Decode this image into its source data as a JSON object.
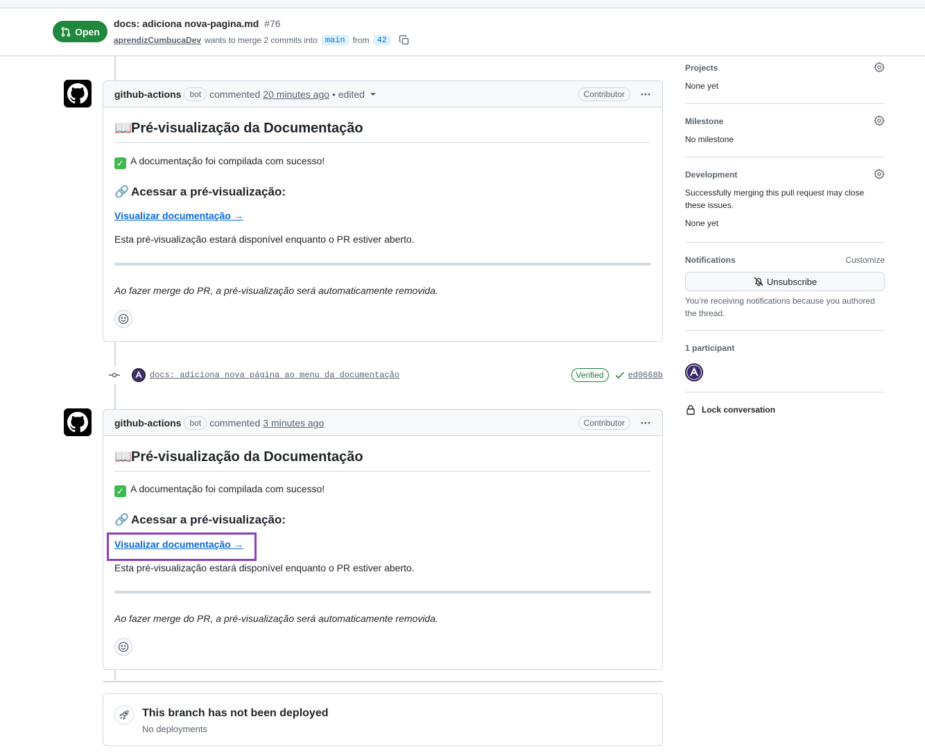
{
  "header": {
    "state": "Open",
    "title": "docs: adiciona nova-pagina.md",
    "number": "#76",
    "author": "aprendizCumbucaDev",
    "merge_text": "wants to merge 2 commits into",
    "base_branch": "main",
    "from_text": "from",
    "head_branch": "42"
  },
  "comments": [
    {
      "author": "github-actions",
      "bot_label": "bot",
      "action": "commented",
      "time": "20 minutes ago",
      "edited": "• edited",
      "role": "Contributor",
      "heading": "Pré-visualização da Documentação",
      "heading_emoji": "📖",
      "success": "A documentação foi compilada com sucesso!",
      "success_emoji": "✓",
      "access_heading": "Acessar a pré-visualização:",
      "access_emoji": "🔗",
      "link": "Visualizar documentação →",
      "availability": "Esta pré-visualização estará disponível enquanto o PR estiver aberto.",
      "footer_note": "Ao fazer merge do PR, a pré-visualização será automaticamente removida."
    },
    {
      "author": "github-actions",
      "bot_label": "bot",
      "action": "commented",
      "time": "3 minutes ago",
      "role": "Contributor",
      "heading": "Pré-visualização da Documentação",
      "heading_emoji": "📖",
      "success": "A documentação foi compilada com sucesso!",
      "success_emoji": "✓",
      "access_heading": "Acessar a pré-visualização:",
      "access_emoji": "🔗",
      "link": "Visualizar documentação →",
      "availability": "Esta pré-visualização estará disponível enquanto o PR estiver aberto.",
      "footer_note": "Ao fazer merge do PR, a pré-visualização será automaticamente removida."
    }
  ],
  "commit": {
    "message": "docs: adiciona nova página ao menu da documentação",
    "verified": "Verified",
    "sha": "ed0668b"
  },
  "deploy": {
    "title": "This branch has not been deployed",
    "subtitle": "No deployments"
  },
  "sidebar": {
    "projects": {
      "heading": "Projects",
      "value": "None yet"
    },
    "milestone": {
      "heading": "Milestone",
      "value": "No milestone"
    },
    "development": {
      "heading": "Development",
      "description": "Successfully merging this pull request may close these issues.",
      "value": "None yet"
    },
    "notifications": {
      "heading": "Notifications",
      "customize": "Customize",
      "button": "Unsubscribe",
      "note": "You’re receiving notifications because you authored the thread."
    },
    "participants": {
      "heading": "1 participant"
    },
    "lock": "Lock conversation"
  },
  "colors": {
    "open_green": "#1f883d",
    "link_blue": "#0969da",
    "highlight_purple": "#8a3dbd"
  }
}
